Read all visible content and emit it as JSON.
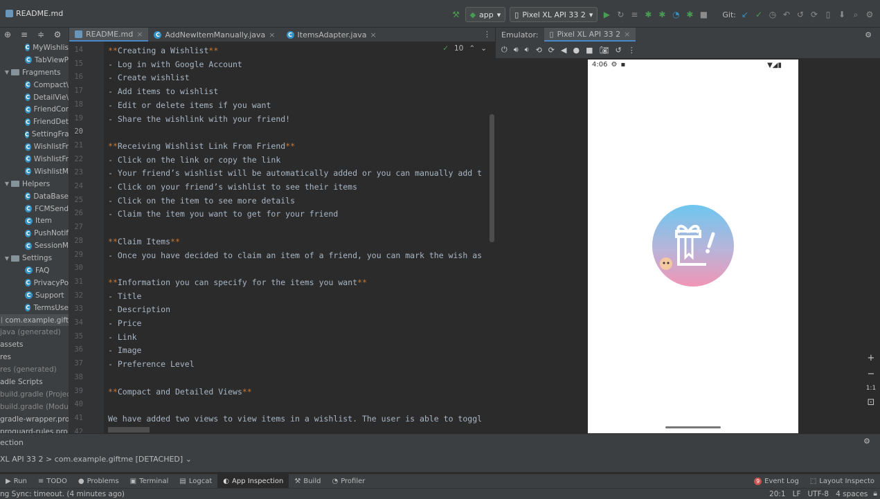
{
  "window": {
    "file_title": "README.md"
  },
  "toolbar": {
    "run_config": "app",
    "device": "Pixel XL API 33 2",
    "git_label": "Git:"
  },
  "editor_tabs": [
    {
      "label": "README.md",
      "type": "md"
    },
    {
      "label": "AddNewItemManually.java",
      "type": "java"
    },
    {
      "label": "ItemsAdapter.java",
      "type": "java"
    }
  ],
  "tree": [
    {
      "label": "MyWishlis",
      "kind": "class",
      "indent": 3
    },
    {
      "label": "TabViewP",
      "kind": "class",
      "indent": 3
    },
    {
      "label": "Fragments",
      "kind": "folder",
      "indent": 2
    },
    {
      "label": "Compact\\",
      "kind": "class",
      "indent": 3
    },
    {
      "label": "DetailVie\\",
      "kind": "class",
      "indent": 3
    },
    {
      "label": "FriendCor",
      "kind": "class",
      "indent": 3
    },
    {
      "label": "FriendDet",
      "kind": "class",
      "indent": 3
    },
    {
      "label": "SettingFra",
      "kind": "class",
      "indent": 3
    },
    {
      "label": "WishlistFr",
      "kind": "class",
      "indent": 3
    },
    {
      "label": "WishlistFr",
      "kind": "class",
      "indent": 3
    },
    {
      "label": "WishlistM",
      "kind": "class",
      "indent": 3
    },
    {
      "label": "Helpers",
      "kind": "folder",
      "indent": 2
    },
    {
      "label": "DataBase",
      "kind": "class",
      "indent": 3
    },
    {
      "label": "FCMSend",
      "kind": "class",
      "indent": 3
    },
    {
      "label": "Item",
      "kind": "class",
      "indent": 3
    },
    {
      "label": "PushNotif",
      "kind": "class",
      "indent": 3
    },
    {
      "label": "SessionM",
      "kind": "class",
      "indent": 3
    },
    {
      "label": "Settings",
      "kind": "folder",
      "indent": 2
    },
    {
      "label": "FAQ",
      "kind": "class",
      "indent": 3
    },
    {
      "label": "PrivacyPo",
      "kind": "class",
      "indent": 3
    },
    {
      "label": "Support",
      "kind": "class",
      "indent": 3
    },
    {
      "label": "TermsUse",
      "kind": "class",
      "indent": 3
    },
    {
      "label": "com.example.gift",
      "kind": "pkg",
      "indent": 1
    },
    {
      "label": "java (generated)",
      "kind": "plain",
      "indent": 0
    },
    {
      "label": "assets",
      "kind": "plain",
      "indent": 0
    },
    {
      "label": "res",
      "kind": "plain",
      "indent": 0
    },
    {
      "label": "res (generated)",
      "kind": "plain",
      "indent": 0
    },
    {
      "label": "adle Scripts",
      "kind": "plain",
      "indent": 0
    },
    {
      "label": "build.gradle (Projec",
      "kind": "plain",
      "indent": 0
    },
    {
      "label": "build.gradle (Modu",
      "kind": "plain",
      "indent": 0
    },
    {
      "label": "gradle-wrapper.pro",
      "kind": "plain",
      "indent": 0
    },
    {
      "label": "proguard-rules.pro",
      "kind": "plain",
      "indent": 0
    }
  ],
  "editor": {
    "inspection_count": "10",
    "lines": [
      {
        "n": "14",
        "text": "**Creating a Wishlist**"
      },
      {
        "n": "15",
        "text": "- Log in with Google Account"
      },
      {
        "n": "16",
        "text": "- Create wishlist"
      },
      {
        "n": "17",
        "text": "- Add items to wishlist"
      },
      {
        "n": "18",
        "text": "- Edit or delete items if you want"
      },
      {
        "n": "19",
        "text": "- Share the wishlink with your friend!"
      },
      {
        "n": "20",
        "text": ""
      },
      {
        "n": "21",
        "text": "**Receiving Wishlist Link From Friend**"
      },
      {
        "n": "22",
        "text": "- Click on the link or copy the link"
      },
      {
        "n": "23",
        "text": "- Your friend’s wishlist will be automatically added or you can manually add t"
      },
      {
        "n": "24",
        "text": "- Click on your friend’s wishlist to see their items"
      },
      {
        "n": "25",
        "text": "- Click on the item to see more details"
      },
      {
        "n": "26",
        "text": "- Claim the item you want to get for your friend"
      },
      {
        "n": "27",
        "text": ""
      },
      {
        "n": "28",
        "text": "**Claim Items**"
      },
      {
        "n": "29",
        "text": "- Once you have decided to claim an item of a friend, you can mark the wish as"
      },
      {
        "n": "30",
        "text": ""
      },
      {
        "n": "31",
        "text": "**Information you can specify for the items you want**"
      },
      {
        "n": "32",
        "text": "- Title"
      },
      {
        "n": "33",
        "text": "- Description"
      },
      {
        "n": "34",
        "text": "- Price"
      },
      {
        "n": "35",
        "text": "- Link"
      },
      {
        "n": "36",
        "text": "- Image"
      },
      {
        "n": "37",
        "text": "- Preference Level"
      },
      {
        "n": "38",
        "text": ""
      },
      {
        "n": "39",
        "text": "**Compact and Detailed Views**"
      },
      {
        "n": "40",
        "text": ""
      },
      {
        "n": "41",
        "text": "We have added two views to view items in a wishlist. The user is able to toggl"
      },
      {
        "n": "42",
        "text": ""
      }
    ]
  },
  "emulator": {
    "label": "Emulator:",
    "tab": "Pixel XL API 33 2",
    "time": "4:06",
    "zoom_ratio": "1:1"
  },
  "bottom_panel": {
    "title": "ection",
    "process": "XL API 33 2 > com.example.giftme [DETACHED]"
  },
  "tool_tabs": [
    "Run",
    "TODO",
    "Problems",
    "Terminal",
    "Logcat",
    "App Inspection",
    "Build",
    "Profiler"
  ],
  "tool_tabs_right": {
    "event_log": "Event Log",
    "event_count": "9",
    "layout_inspector": "Layout Inspecto"
  },
  "statusbar": {
    "message": "ng Sync: timeout. (4 minutes ago)",
    "position": "20:1",
    "line_sep": "LF",
    "encoding": "UTF-8",
    "indent": "4 spaces"
  }
}
